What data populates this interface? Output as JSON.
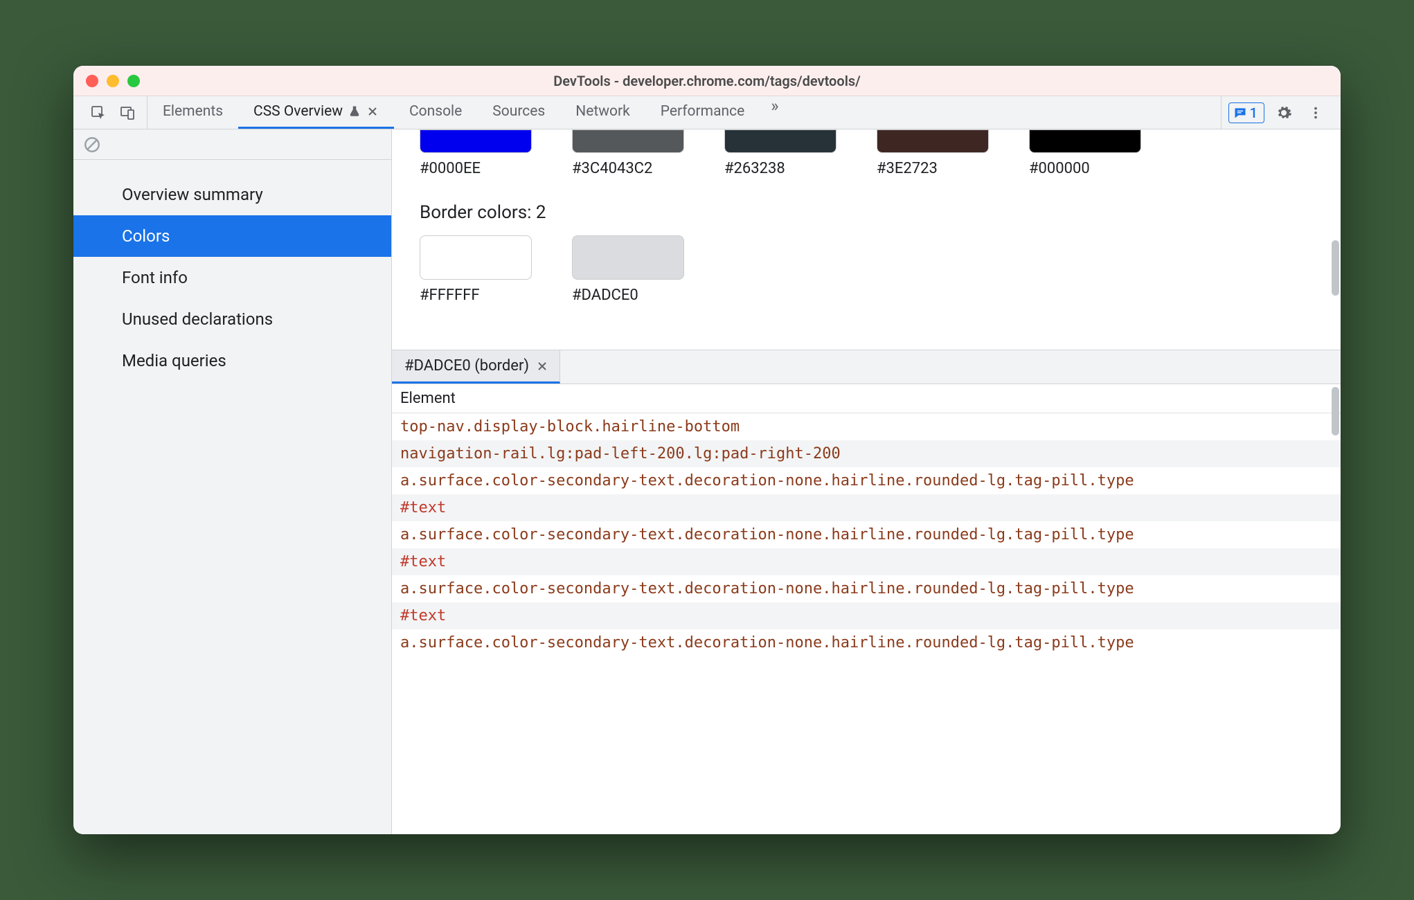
{
  "window": {
    "title": "DevTools - developer.chrome.com/tags/devtools/"
  },
  "toolbar": {
    "tabs": [
      {
        "label": "Elements",
        "active": false
      },
      {
        "label": "CSS Overview",
        "active": true,
        "experimental": true,
        "closable": true
      },
      {
        "label": "Console",
        "active": false
      },
      {
        "label": "Sources",
        "active": false
      },
      {
        "label": "Network",
        "active": false
      },
      {
        "label": "Performance",
        "active": false
      }
    ],
    "more_glyph": "»",
    "issues_count": "1"
  },
  "sidebar": {
    "items": [
      {
        "label": "Overview summary"
      },
      {
        "label": "Colors"
      },
      {
        "label": "Font info"
      },
      {
        "label": "Unused declarations"
      },
      {
        "label": "Media queries"
      }
    ],
    "selected_index": 1
  },
  "colors_panel": {
    "top_swatches": [
      {
        "hex": "#0000EE",
        "fill": "#0000EE"
      },
      {
        "hex": "#3C4043C2",
        "fill": "#54585b"
      },
      {
        "hex": "#263238",
        "fill": "#263238"
      },
      {
        "hex": "#3E2723",
        "fill": "#3E2723"
      },
      {
        "hex": "#000000",
        "fill": "#000000"
      }
    ],
    "border_section_title": "Border colors: 2",
    "border_swatches": [
      {
        "hex": "#FFFFFF",
        "fill": "#FFFFFF"
      },
      {
        "hex": "#DADCE0",
        "fill": "#DADCE0"
      }
    ]
  },
  "detail": {
    "tab_label": "#DADCE0 (border)",
    "header": "Element",
    "rows": [
      {
        "text": "top-nav.display-block.hairline-bottom",
        "type": "el"
      },
      {
        "text": "navigation-rail.lg:pad-left-200.lg:pad-right-200",
        "type": "el"
      },
      {
        "text": "a.surface.color-secondary-text.decoration-none.hairline.rounded-lg.tag-pill.type",
        "type": "el"
      },
      {
        "text": "#text",
        "type": "text"
      },
      {
        "text": "a.surface.color-secondary-text.decoration-none.hairline.rounded-lg.tag-pill.type",
        "type": "el"
      },
      {
        "text": "#text",
        "type": "text"
      },
      {
        "text": "a.surface.color-secondary-text.decoration-none.hairline.rounded-lg.tag-pill.type",
        "type": "el"
      },
      {
        "text": "#text",
        "type": "text"
      },
      {
        "text": "a.surface.color-secondary-text.decoration-none.hairline.rounded-lg.tag-pill.type",
        "type": "el"
      }
    ]
  }
}
